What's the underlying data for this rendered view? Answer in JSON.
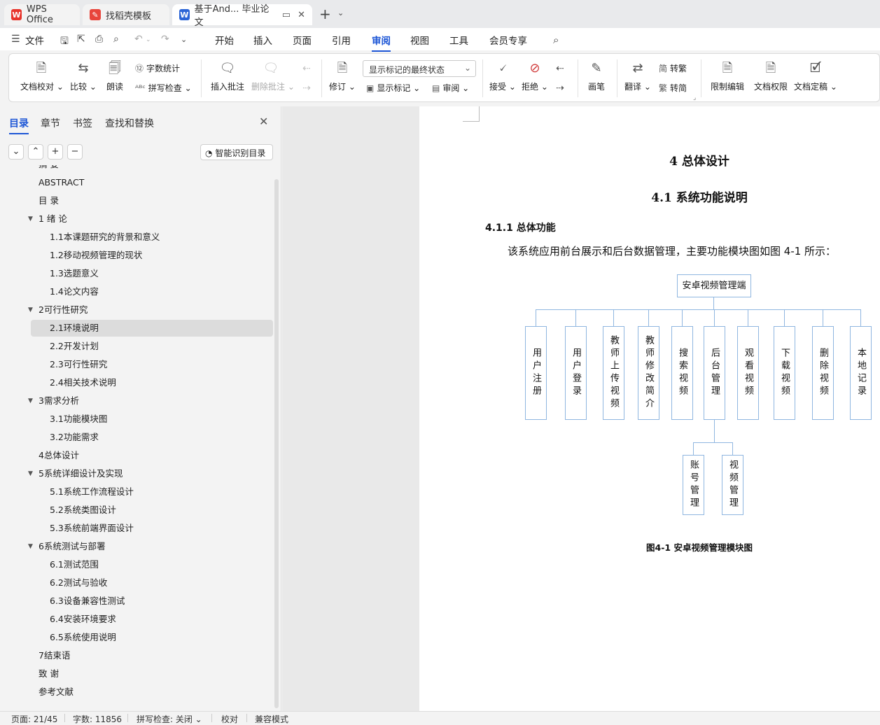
{
  "tabs": [
    {
      "label": "WPS Office",
      "icon": "wps-logo-icon"
    },
    {
      "label": "找稻壳模板",
      "icon": "docer-icon"
    },
    {
      "label": "基于And... 毕业论文",
      "icon": "writer-doc-icon"
    }
  ],
  "menu": {
    "file": "文件",
    "items": [
      "开始",
      "插入",
      "页面",
      "引用",
      "审阅",
      "视图",
      "工具",
      "会员专享"
    ],
    "active": "审阅"
  },
  "ribbon": {
    "doc_check": "文档校对",
    "compare": "比较",
    "read_aloud": "朗读",
    "word_count": "字数统计",
    "spell_check": "拼写检查",
    "insert_comment": "插入批注",
    "delete_comment": "删除批注",
    "revise": "修订",
    "display_state": "显示标记的最终状态",
    "show_markup": "显示标记",
    "review": "审阅",
    "accept": "接受",
    "reject": "拒绝",
    "pen": "画笔",
    "translate": "翻译",
    "to_traditional": "转繁",
    "to_simplified": "转简",
    "restrict_edit": "限制编辑",
    "doc_permission": "文档权限",
    "finalize": "文档定稿"
  },
  "side_panel": {
    "tabs": [
      "目录",
      "章节",
      "书签",
      "查找和替换"
    ],
    "active_tab": "目录",
    "smart_toc": "智能识别目录",
    "toc": [
      {
        "label": "摘 要",
        "level": 1
      },
      {
        "label": "ABSTRACT",
        "level": 1
      },
      {
        "label": "目 录",
        "level": 1
      },
      {
        "label": "1 绪 论",
        "level": 1,
        "expanded": true
      },
      {
        "label": "1.1本课题研究的背景和意义",
        "level": 2
      },
      {
        "label": "1.2移动视频管理的现状",
        "level": 2
      },
      {
        "label": "1.3选题意义",
        "level": 2
      },
      {
        "label": "1.4论文内容",
        "level": 2
      },
      {
        "label": "2可行性研究",
        "level": 1,
        "expanded": true
      },
      {
        "label": "2.1环境说明",
        "level": 2,
        "selected": true
      },
      {
        "label": "2.2开发计划",
        "level": 2
      },
      {
        "label": "2.3可行性研究",
        "level": 2
      },
      {
        "label": "2.4相关技术说明",
        "level": 2
      },
      {
        "label": "3需求分析",
        "level": 1,
        "expanded": true
      },
      {
        "label": "3.1功能模块图",
        "level": 2
      },
      {
        "label": "3.2功能需求",
        "level": 2
      },
      {
        "label": "4总体设计",
        "level": 1
      },
      {
        "label": "5系统详细设计及实现",
        "level": 1,
        "expanded": true
      },
      {
        "label": "5.1系统工作流程设计",
        "level": 2
      },
      {
        "label": "5.2系统类图设计",
        "level": 2
      },
      {
        "label": "5.3系统前端界面设计",
        "level": 2
      },
      {
        "label": "6系统测试与部署",
        "level": 1,
        "expanded": true
      },
      {
        "label": "6.1测试范围",
        "level": 2
      },
      {
        "label": "6.2测试与验收",
        "level": 2
      },
      {
        "label": "6.3设备兼容性测试",
        "level": 2
      },
      {
        "label": "6.4安装环境要求",
        "level": 2
      },
      {
        "label": "6.5系统使用说明",
        "level": 2
      },
      {
        "label": "7结束语",
        "level": 1
      },
      {
        "label": "致 谢",
        "level": 1
      },
      {
        "label": "参考文献",
        "level": 1
      }
    ]
  },
  "document": {
    "chapter": "4  总体设计",
    "section": "4.1  系统功能说明",
    "subsection": "4.1.1  总体功能",
    "paragraph": "该系统应用前台展示和后台数据管理，主要功能模块图如图 4-1 所示：",
    "diagram": {
      "root": "安卓视频管理端",
      "modules": [
        "用户注册",
        "用户登录",
        "教师上传视频",
        "教师修改简介",
        "搜索视频",
        "后台管理",
        "观看视频",
        "下载视频",
        "删除视频",
        "本地记录"
      ],
      "sub_parent": "后台管理",
      "submodules": [
        "账号管理",
        "视频管理"
      ]
    },
    "caption": "图4-1   安卓视频管理模块图"
  },
  "status_bar": {
    "page": "页面: 21/45",
    "words": "字数: 11856",
    "spell": "拼写检查: 关闭",
    "proof": "校对",
    "compat": "兼容模式"
  }
}
